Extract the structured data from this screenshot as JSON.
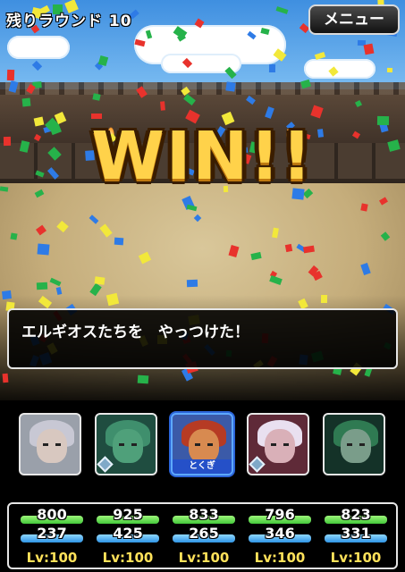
{
  "header": {
    "round_text": "残りラウンド 10",
    "menu_label": "メニュー"
  },
  "banner": {
    "text": "WIN!!"
  },
  "message": {
    "text": "エルギオスたちを　やっつけた！"
  },
  "party": [
    {
      "name": "member-1",
      "selected": false,
      "badge": "",
      "has_gem": false,
      "hp": 800,
      "mp": 237,
      "level": "Lv:100",
      "colors": {
        "bg": "#9aa0aa",
        "hair": "#c8c8d4",
        "face": "#d8c8c0"
      }
    },
    {
      "name": "member-2",
      "selected": false,
      "badge": "",
      "has_gem": true,
      "hp": 925,
      "mp": 425,
      "level": "Lv:100",
      "colors": {
        "bg": "#1f4d40",
        "hair": "#3f8f6d",
        "face": "#4fa07a"
      }
    },
    {
      "name": "member-3",
      "selected": true,
      "badge": "とくぎ",
      "has_gem": false,
      "hp": 833,
      "mp": 265,
      "level": "Lv:100",
      "colors": {
        "bg": "#3b5aa8",
        "hair": "#b63b24",
        "face": "#d88a50"
      }
    },
    {
      "name": "member-4",
      "selected": false,
      "badge": "",
      "has_gem": true,
      "hp": 796,
      "mp": 346,
      "level": "Lv:100",
      "colors": {
        "bg": "#5f2a38",
        "hair": "#e9e0f0",
        "face": "#d9b0b8"
      }
    },
    {
      "name": "member-5",
      "selected": false,
      "badge": "",
      "has_gem": false,
      "hp": 823,
      "mp": 331,
      "level": "Lv:100",
      "colors": {
        "bg": "#143228",
        "hair": "#2f7a52",
        "face": "#7a9d8a"
      }
    }
  ]
}
